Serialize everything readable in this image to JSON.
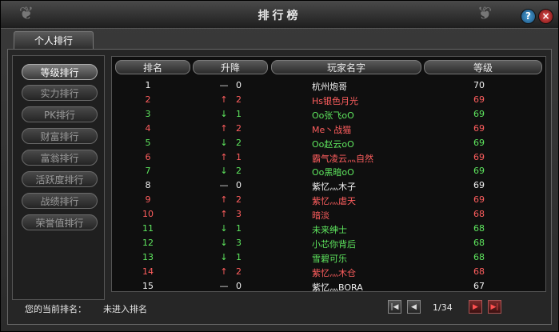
{
  "window": {
    "title": "排行榜",
    "help_label": "?",
    "close_label": "×"
  },
  "tabs": [
    {
      "label": "个人排行"
    }
  ],
  "sidebar": {
    "items": [
      {
        "label": "等级排行",
        "active": true
      },
      {
        "label": "实力排行",
        "active": false
      },
      {
        "label": "PK排行",
        "active": false
      },
      {
        "label": "财富排行",
        "active": false
      },
      {
        "label": "富翁排行",
        "active": false
      },
      {
        "label": "活跃度排行",
        "active": false
      },
      {
        "label": "战绩排行",
        "active": false
      },
      {
        "label": "荣誉值排行",
        "active": false
      }
    ]
  },
  "table": {
    "headers": {
      "rank": "排名",
      "change": "升降",
      "name": "玩家名字",
      "level": "等级"
    },
    "rows": [
      {
        "rank": "1",
        "arrow": "—",
        "change": "0",
        "name": "杭州炮哥",
        "level": "70",
        "color": "white"
      },
      {
        "rank": "2",
        "arrow": "↑",
        "change": "2",
        "name": "Hs银色月光",
        "level": "69",
        "color": "red"
      },
      {
        "rank": "3",
        "arrow": "↓",
        "change": "1",
        "name": "Oo张飞oO",
        "level": "69",
        "color": "green"
      },
      {
        "rank": "4",
        "arrow": "↑",
        "change": "2",
        "name": "Me丶战猫",
        "level": "69",
        "color": "red"
      },
      {
        "rank": "5",
        "arrow": "↓",
        "change": "2",
        "name": "Oo赵云oO",
        "level": "69",
        "color": "green"
      },
      {
        "rank": "6",
        "arrow": "↑",
        "change": "1",
        "name": "霸气凌云灬自然",
        "level": "69",
        "color": "red"
      },
      {
        "rank": "7",
        "arrow": "↓",
        "change": "2",
        "name": "Oo黑暗oO",
        "level": "69",
        "color": "green"
      },
      {
        "rank": "8",
        "arrow": "—",
        "change": "0",
        "name": "紫忆灬木子",
        "level": "69",
        "color": "white"
      },
      {
        "rank": "9",
        "arrow": "↑",
        "change": "2",
        "name": "紫忆灬虐天",
        "level": "69",
        "color": "red"
      },
      {
        "rank": "10",
        "arrow": "↑",
        "change": "3",
        "name": "暗淡",
        "level": "68",
        "color": "red"
      },
      {
        "rank": "11",
        "arrow": "↓",
        "change": "1",
        "name": "未来绅士",
        "level": "68",
        "color": "green"
      },
      {
        "rank": "12",
        "arrow": "↓",
        "change": "3",
        "name": "小芯你背后",
        "level": "68",
        "color": "green"
      },
      {
        "rank": "13",
        "arrow": "↓",
        "change": "1",
        "name": "雪碧可乐",
        "level": "68",
        "color": "green"
      },
      {
        "rank": "14",
        "arrow": "↑",
        "change": "2",
        "name": "紫忆灬木仓",
        "level": "68",
        "color": "red"
      },
      {
        "rank": "15",
        "arrow": "—",
        "change": "0",
        "name": "紫忆灬BORA",
        "level": "67",
        "color": "white"
      }
    ]
  },
  "footer": {
    "current_rank_label": "您的当前排名：",
    "current_rank_value": "未进入排名",
    "page_indicator": "1/34",
    "buttons": {
      "first": "|◀",
      "prev": "◀",
      "next": "▶",
      "last": "▶|"
    }
  },
  "colors": {
    "up": "#ff5e5e",
    "down": "#5ee65e",
    "same": "#f0f0f0"
  }
}
